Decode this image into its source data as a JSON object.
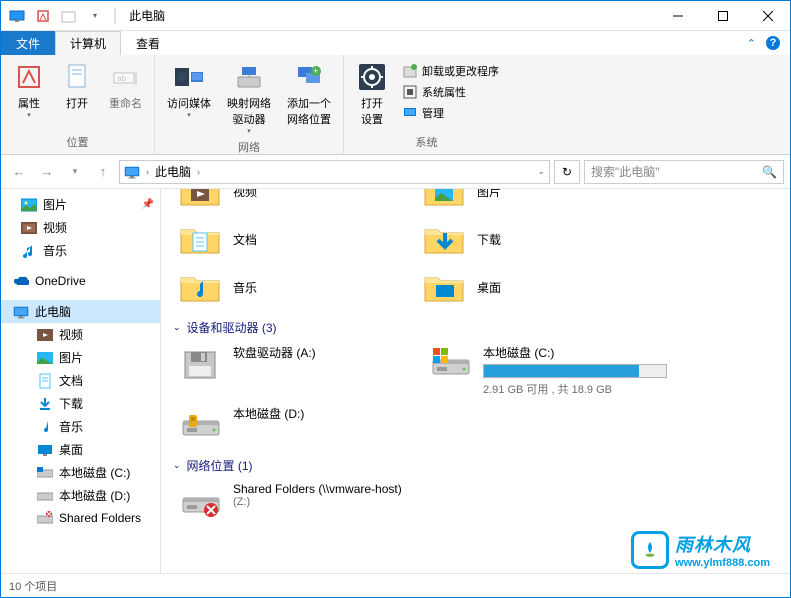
{
  "window": {
    "title": "此电脑"
  },
  "tabs": {
    "file": "文件",
    "computer": "计算机",
    "view": "查看"
  },
  "ribbon": {
    "location": {
      "properties": "属性",
      "open": "打开",
      "rename": "重命名",
      "group": "位置"
    },
    "network": {
      "media": "访问媒体",
      "map": "映射网络\n驱动器",
      "add": "添加一个\n网络位置",
      "group": "网络"
    },
    "system": {
      "settings": "打开\n设置",
      "uninstall": "卸载或更改程序",
      "sysprops": "系统属性",
      "manage": "管理",
      "group": "系统"
    }
  },
  "address": {
    "root": "此电脑"
  },
  "search": {
    "placeholder": "搜索\"此电脑\""
  },
  "tree": {
    "pictures": "图片",
    "videos": "视频",
    "music": "音乐",
    "onedrive": "OneDrive",
    "thispc": "此电脑",
    "pc_videos": "视频",
    "pc_pictures": "图片",
    "pc_documents": "文档",
    "pc_downloads": "下载",
    "pc_music": "音乐",
    "pc_desktop": "桌面",
    "drive_c": "本地磁盘 (C:)",
    "drive_d": "本地磁盘 (D:)",
    "shared": "Shared Folders"
  },
  "folders": {
    "videos_partial": "视频",
    "pictures_partial": "图片",
    "documents": "文档",
    "downloads": "下载",
    "music": "音乐",
    "desktop": "桌面"
  },
  "sections": {
    "devices": "设备和驱动器 (3)",
    "network": "网络位置 (1)"
  },
  "drives": {
    "a": {
      "name": "软盘驱动器 (A:)"
    },
    "c": {
      "name": "本地磁盘 (C:)",
      "info": "2.91 GB 可用 , 共 18.9 GB",
      "used_pct": 85
    },
    "d": {
      "name": "本地磁盘 (D:)"
    },
    "shared": {
      "name": "Shared Folders (\\\\vmware-host)",
      "letter": "(Z:)"
    }
  },
  "status": {
    "count": "10 个项目"
  },
  "watermark": {
    "name": "雨林木风",
    "url": "www.ylmf888.com"
  }
}
